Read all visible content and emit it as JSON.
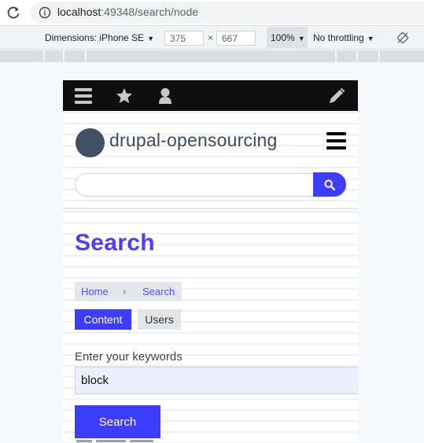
{
  "browser": {
    "url_host": "localhost",
    "url_rest": ":49348/search/node"
  },
  "devtools": {
    "device": "Dimensions: iPhone SE",
    "width": "375",
    "height": "667",
    "times": "×",
    "zoom": "100%",
    "throttle": "No throttling"
  },
  "site": {
    "name": "drupal-opensourcing",
    "search_placeholder": ""
  },
  "page": {
    "title": "Search",
    "breadcrumb": [
      {
        "label": "Home"
      },
      {
        "label": "›"
      },
      {
        "label": "Search"
      }
    ],
    "tabs": [
      {
        "label": "Content",
        "active": true
      },
      {
        "label": "Users",
        "active": false
      }
    ],
    "keywords_label": "Enter your keywords",
    "keywords_value": "block",
    "submit_label": "Search"
  },
  "colors": {
    "accent": "#3e3dff",
    "admin_bar": "#0f0f0f",
    "title": "#4c3dff"
  },
  "icons": {
    "admin_bar": [
      "menu-icon",
      "star-icon",
      "user-icon",
      "pencil-icon"
    ],
    "search": "search-icon",
    "browser": [
      "reload-icon",
      "info-icon",
      "rotate-icon"
    ]
  }
}
